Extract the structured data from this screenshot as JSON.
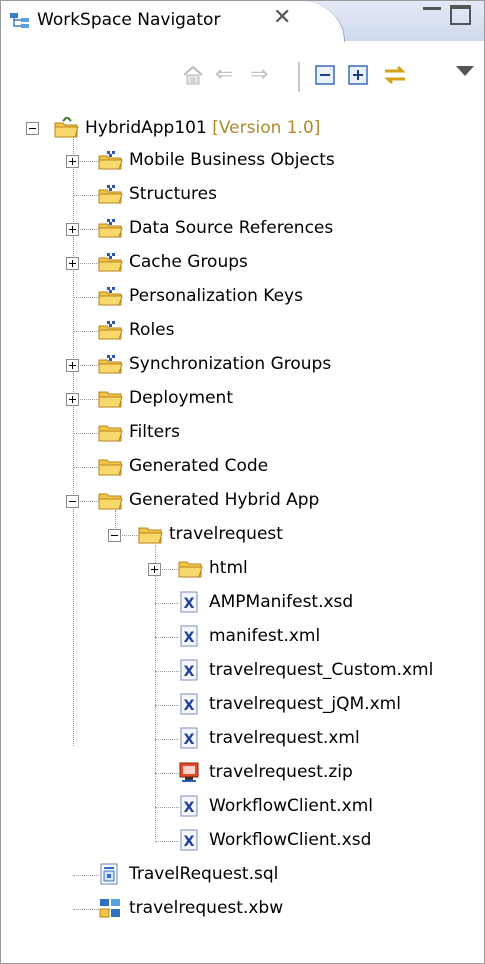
{
  "panel": {
    "title": "WorkSpace Navigator",
    "close_glyph": "✕"
  },
  "toolbar": {
    "home_icon": "home-icon",
    "back_glyph": "⇐",
    "forward_glyph": "⇒",
    "collapse_icon": "collapse-all-icon",
    "expand_icon": "expand-all-icon",
    "link_icon": "link-with-editor-icon",
    "menu_icon": "view-menu-icon"
  },
  "tree": {
    "root": {
      "label": "HybridApp101",
      "version": "[Version 1.0]"
    },
    "items": [
      {
        "label": "Mobile Business Objects"
      },
      {
        "label": "Structures"
      },
      {
        "label": "Data Source References"
      },
      {
        "label": "Cache Groups"
      },
      {
        "label": "Personalization Keys"
      },
      {
        "label": "Roles"
      },
      {
        "label": "Synchronization Groups"
      },
      {
        "label": "Deployment"
      },
      {
        "label": "Filters"
      },
      {
        "label": "Generated Code"
      },
      {
        "label": "Generated Hybrid App"
      }
    ],
    "travelrequest": {
      "label": "travelrequest"
    },
    "files": [
      {
        "label": "html"
      },
      {
        "label": "AMPManifest.xsd"
      },
      {
        "label": "manifest.xml"
      },
      {
        "label": "travelrequest_Custom.xml"
      },
      {
        "label": "travelrequest_jQM.xml"
      },
      {
        "label": "travelrequest.xml"
      },
      {
        "label": "travelrequest.zip"
      },
      {
        "label": "WorkflowClient.xml"
      },
      {
        "label": "WorkflowClient.xsd"
      }
    ],
    "bottom": [
      {
        "label": "TravelRequest.sql"
      },
      {
        "label": "travelrequest.xbw"
      }
    ]
  },
  "colors": {
    "folder": "#f5c74a",
    "folder_dark": "#c8921c",
    "version_text": "#b08a2c",
    "xml_blue": "#1f3f9a"
  }
}
